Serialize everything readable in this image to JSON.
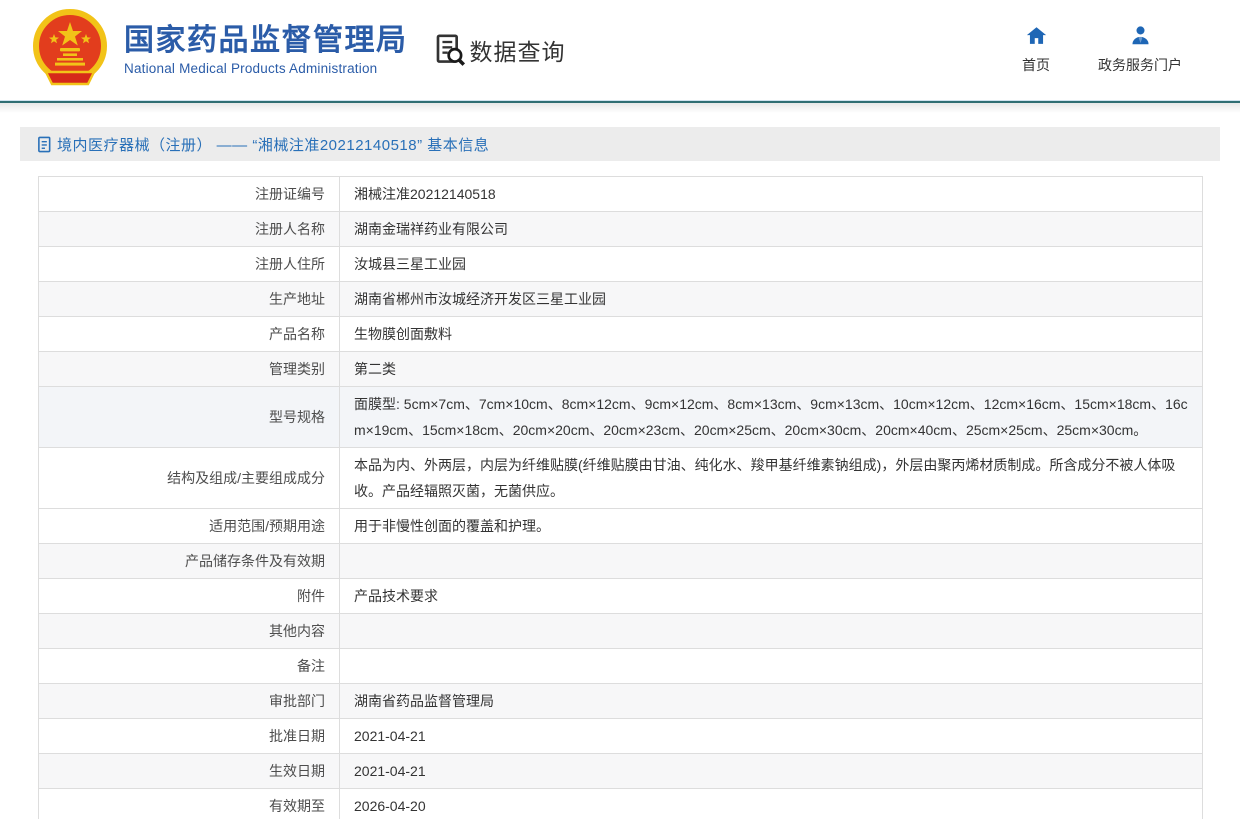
{
  "header": {
    "logo_icon": "china-national-emblem",
    "title_cn": "国家药品监督管理局",
    "title_en": "National Medical Products Administration",
    "section": {
      "icon": "document-search-icon",
      "label": "数据查询"
    },
    "nav": [
      {
        "icon": "home-icon",
        "label": "首页"
      },
      {
        "icon": "user-icon",
        "label": "政务服务门户"
      }
    ]
  },
  "breadcrumb": {
    "icon": "document-icon",
    "text": "境内医疗器械（注册） —— “湘械注准20212140518” 基本信息"
  },
  "colors": {
    "brand_blue": "#2b5ca8",
    "link_blue": "#2970b8",
    "icon_blue": "#1e66b5",
    "teal_rule": "#2f6d72",
    "bar_bg": "#ececec",
    "row_alt": "#f7f7f8",
    "border": "#dddddd"
  },
  "table": {
    "rows": [
      {
        "label": "注册证编号",
        "value": "湘械注准20212140518"
      },
      {
        "label": "注册人名称",
        "value": "湖南金瑞祥药业有限公司"
      },
      {
        "label": "注册人住所",
        "value": "汝城县三星工业园"
      },
      {
        "label": "生产地址",
        "value": "湖南省郴州市汝城经济开发区三星工业园"
      },
      {
        "label": "产品名称",
        "value": "生物膜创面敷料"
      },
      {
        "label": "管理类别",
        "value": "第二类"
      },
      {
        "label": "型号规格",
        "value": "面膜型: 5cm×7cm、7cm×10cm、8cm×12cm、9cm×12cm、8cm×13cm、9cm×13cm、10cm×12cm、12cm×16cm、15cm×18cm、16cm×19cm、15cm×18cm、20cm×20cm、20cm×23cm、20cm×25cm、20cm×30cm、20cm×40cm、25cm×25cm、25cm×30cm。"
      },
      {
        "label": "结构及组成/主要组成成分",
        "value": "本品为内、外两层，内层为纤维贴膜(纤维贴膜由甘油、纯化水、羧甲基纤维素钠组成)，外层由聚丙烯材质制成。所含成分不被人体吸收。产品经辐照灭菌，无菌供应。"
      },
      {
        "label": "适用范围/预期用途",
        "value": "用于非慢性创面的覆盖和护理。"
      },
      {
        "label": "产品储存条件及有效期",
        "value": ""
      },
      {
        "label": "附件",
        "value": "产品技术要求"
      },
      {
        "label": "其他内容",
        "value": ""
      },
      {
        "label": "备注",
        "value": ""
      },
      {
        "label": "审批部门",
        "value": "湖南省药品监督管理局"
      },
      {
        "label": "批准日期",
        "value": "2021-04-21"
      },
      {
        "label": "生效日期",
        "value": "2021-04-21"
      },
      {
        "label": "有效期至",
        "value": "2026-04-20"
      }
    ]
  }
}
